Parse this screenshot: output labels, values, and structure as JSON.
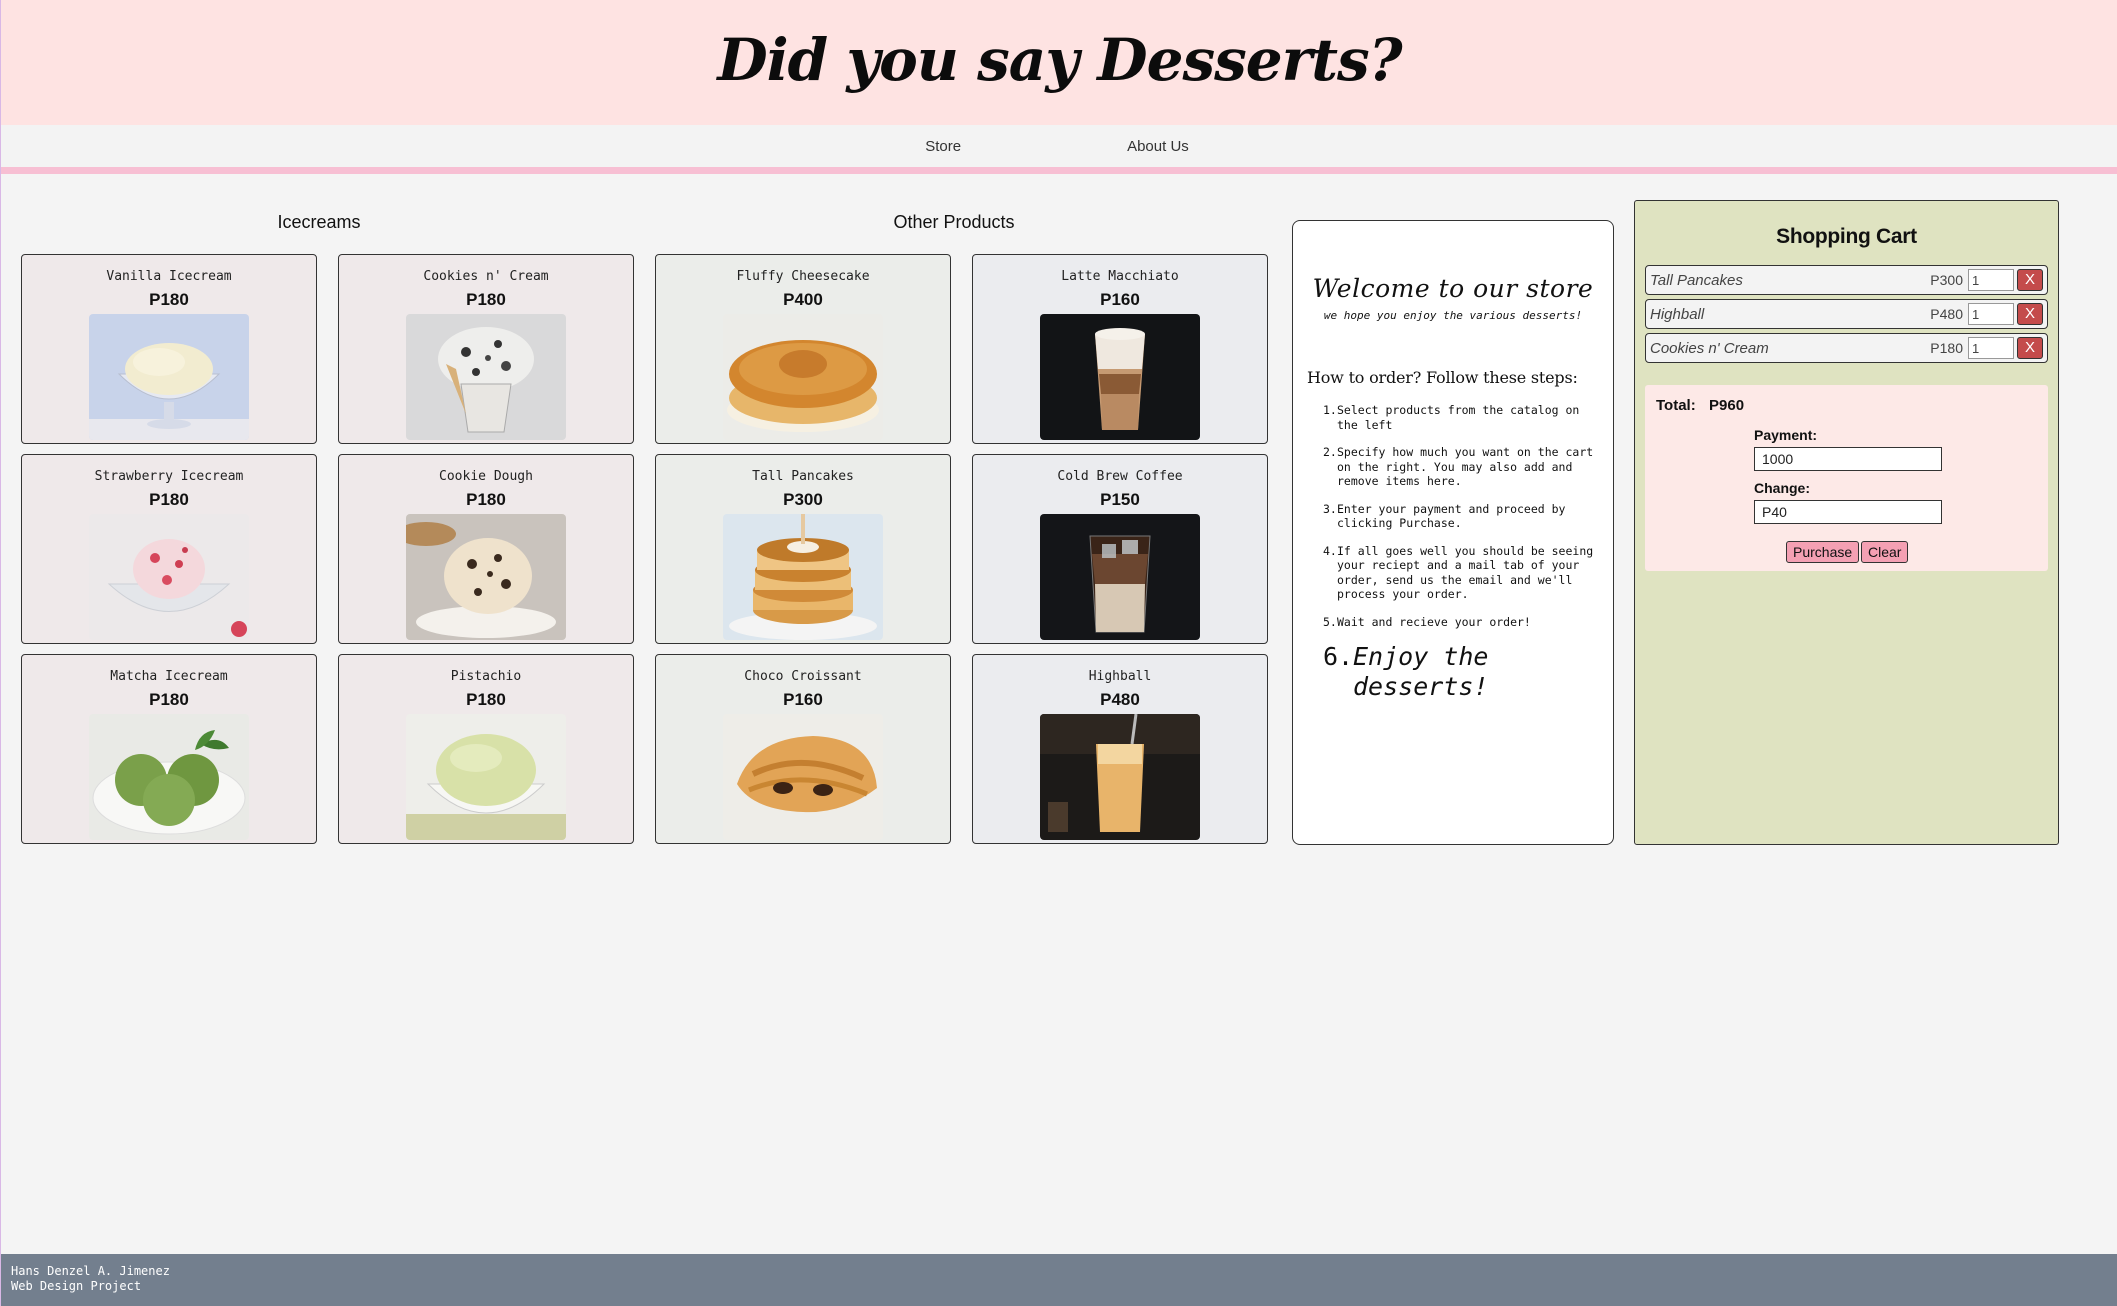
{
  "header": {
    "title": "Did you say Desserts?"
  },
  "nav": {
    "store": "Store",
    "about": "About Us"
  },
  "sections": {
    "icecreams": "Icecreams",
    "other": "Other Products"
  },
  "products": [
    {
      "name": "Vanilla Icecream",
      "price": "P180"
    },
    {
      "name": "Cookies n' Cream",
      "price": "P180"
    },
    {
      "name": "Fluffy Cheesecake",
      "price": "P400"
    },
    {
      "name": "Latte Macchiato",
      "price": "P160"
    },
    {
      "name": "Strawberry Icecream",
      "price": "P180"
    },
    {
      "name": "Cookie Dough",
      "price": "P180"
    },
    {
      "name": "Tall Pancakes",
      "price": "P300"
    },
    {
      "name": "Cold Brew Coffee",
      "price": "P150"
    },
    {
      "name": "Matcha Icecream",
      "price": "P180"
    },
    {
      "name": "Pistachio",
      "price": "P180"
    },
    {
      "name": "Choco Croissant",
      "price": "P160"
    },
    {
      "name": "Highball",
      "price": "P480"
    }
  ],
  "welcome": {
    "title": "Welcome to our store",
    "subtitle": "we hope you enjoy the various desserts!",
    "how": "How to order? Follow these steps:",
    "steps": [
      {
        "num": "1.",
        "text": "Select products from the catalog on the left"
      },
      {
        "num": "2.",
        "text": "Specify how much you want on the cart on the right. You may also add and remove items here."
      },
      {
        "num": "3.",
        "text": "Enter your payment and proceed by clicking Purchase."
      },
      {
        "num": "4.",
        "text": "If all goes well you should be seeing your reciept and a mail tab of your order, send us the email and we'll process your order."
      },
      {
        "num": "5.",
        "text": "Wait and recieve your order!"
      },
      {
        "num": "6.",
        "text": "Enjoy the desserts!"
      }
    ]
  },
  "cart": {
    "title": "Shopping Cart",
    "items": [
      {
        "name": "Tall Pancakes",
        "price": "P300",
        "qty": "1",
        "remove": "X"
      },
      {
        "name": "Highball",
        "price": "P480",
        "qty": "1",
        "remove": "X"
      },
      {
        "name": "Cookies n' Cream",
        "price": "P180",
        "qty": "1",
        "remove": "X"
      }
    ],
    "total_label": "Total:",
    "total": "P960",
    "payment_label": "Payment:",
    "payment": "1000",
    "change_label": "Change:",
    "change": "P40",
    "purchase": "Purchase",
    "clear": "Clear"
  },
  "footer": {
    "line1": "Hans Denzel A. Jimenez",
    "line2": "Web Design Project"
  }
}
